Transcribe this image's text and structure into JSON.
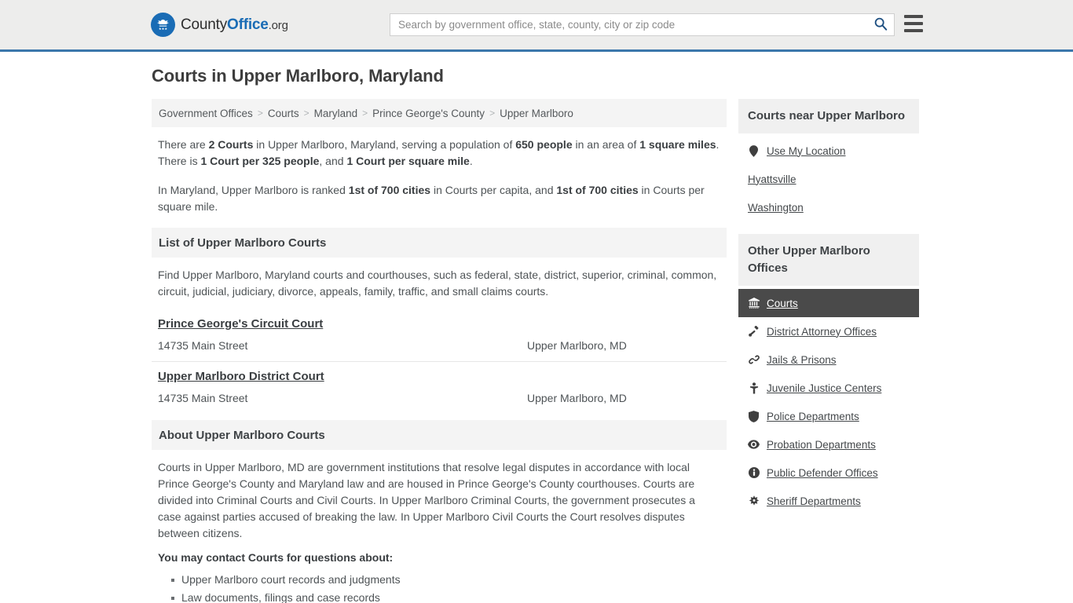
{
  "header": {
    "logo": {
      "icon": "eagle-shield-icon",
      "text_county": "County",
      "text_office": "Office",
      "text_org": ".org"
    },
    "search": {
      "placeholder": "Search by government office, state, county, city or zip code",
      "value": "",
      "search_icon": "search-icon"
    },
    "menu_icon": "hamburger-menu-icon",
    "accent_color": "#3b77ab",
    "background_color": "#ededec"
  },
  "page_title": "Courts in Upper Marlboro, Maryland",
  "breadcrumb": {
    "separator": ">",
    "items": [
      {
        "label": "Government Offices"
      },
      {
        "label": "Courts"
      },
      {
        "label": "Maryland"
      },
      {
        "label": "Prince George's County"
      },
      {
        "label": "Upper Marlboro"
      }
    ]
  },
  "stats": {
    "para1": [
      {
        "text": "There are ",
        "bold": false
      },
      {
        "text": "2 Courts",
        "bold": true
      },
      {
        "text": " in Upper Marlboro, Maryland, serving a population of ",
        "bold": false
      },
      {
        "text": "650 people",
        "bold": true
      },
      {
        "text": " in an area of ",
        "bold": false
      },
      {
        "text": "1 square miles",
        "bold": true
      },
      {
        "text": ". There is ",
        "bold": false
      },
      {
        "text": "1 Court per 325 people",
        "bold": true
      },
      {
        "text": ", and ",
        "bold": false
      },
      {
        "text": "1 Court per square mile",
        "bold": true
      },
      {
        "text": ".",
        "bold": false
      }
    ],
    "para2": [
      {
        "text": "In Maryland, Upper Marlboro is ranked ",
        "bold": false
      },
      {
        "text": "1st of 700 cities",
        "bold": true
      },
      {
        "text": " in Courts per capita, and ",
        "bold": false
      },
      {
        "text": "1st of 700 cities",
        "bold": true
      },
      {
        "text": " in Courts per square mile.",
        "bold": false
      }
    ]
  },
  "list_section": {
    "heading": "List of Upper Marlboro Courts",
    "description": "Find Upper Marlboro, Maryland courts and courthouses, such as federal, state, district, superior, criminal, common, circuit, judicial, judiciary, divorce, appeals, family, traffic, and small claims courts.",
    "courts": [
      {
        "name": "Prince George's Circuit Court",
        "address": "14735 Main Street",
        "city_state": "Upper Marlboro, MD"
      },
      {
        "name": "Upper Marlboro District Court",
        "address": "14735 Main Street",
        "city_state": "Upper Marlboro, MD"
      }
    ]
  },
  "about_section": {
    "heading": "About Upper Marlboro Courts",
    "body": "Courts in Upper Marlboro, MD are government institutions that resolve legal disputes in accordance with local Prince George's County and Maryland law and are housed in Prince George's County courthouses. Courts are divided into Criminal Courts and Civil Courts. In Upper Marlboro Criminal Courts, the government prosecutes a case against parties accused of breaking the law. In Upper Marlboro Civil Courts the Court resolves disputes between citizens.",
    "contact_heading": "You may contact Courts for questions about:",
    "contact_items": [
      "Upper Marlboro court records and judgments",
      "Law documents, filings and case records"
    ]
  },
  "sidebar": {
    "nearby": {
      "heading": "Courts near Upper Marlboro",
      "items": [
        {
          "label": "Use My Location",
          "icon": "map-pin-icon"
        },
        {
          "label": "Hyattsville",
          "icon": ""
        },
        {
          "label": "Washington",
          "icon": ""
        }
      ]
    },
    "offices": {
      "heading": "Other Upper Marlboro Offices",
      "active_color": "#4a4a4a",
      "items": [
        {
          "label": "Courts",
          "icon": "courthouse-icon",
          "active": true
        },
        {
          "label": "District Attorney Offices",
          "icon": "gavel-icon",
          "active": false
        },
        {
          "label": "Jails & Prisons",
          "icon": "handcuffs-icon",
          "active": false
        },
        {
          "label": "Juvenile Justice Centers",
          "icon": "child-icon",
          "active": false
        },
        {
          "label": "Police Departments",
          "icon": "shield-icon",
          "active": false
        },
        {
          "label": "Probation Departments",
          "icon": "eye-icon",
          "active": false
        },
        {
          "label": "Public Defender Offices",
          "icon": "info-circle-icon",
          "active": false
        },
        {
          "label": "Sheriff Departments",
          "icon": "sheriff-star-icon",
          "active": false
        }
      ]
    }
  }
}
